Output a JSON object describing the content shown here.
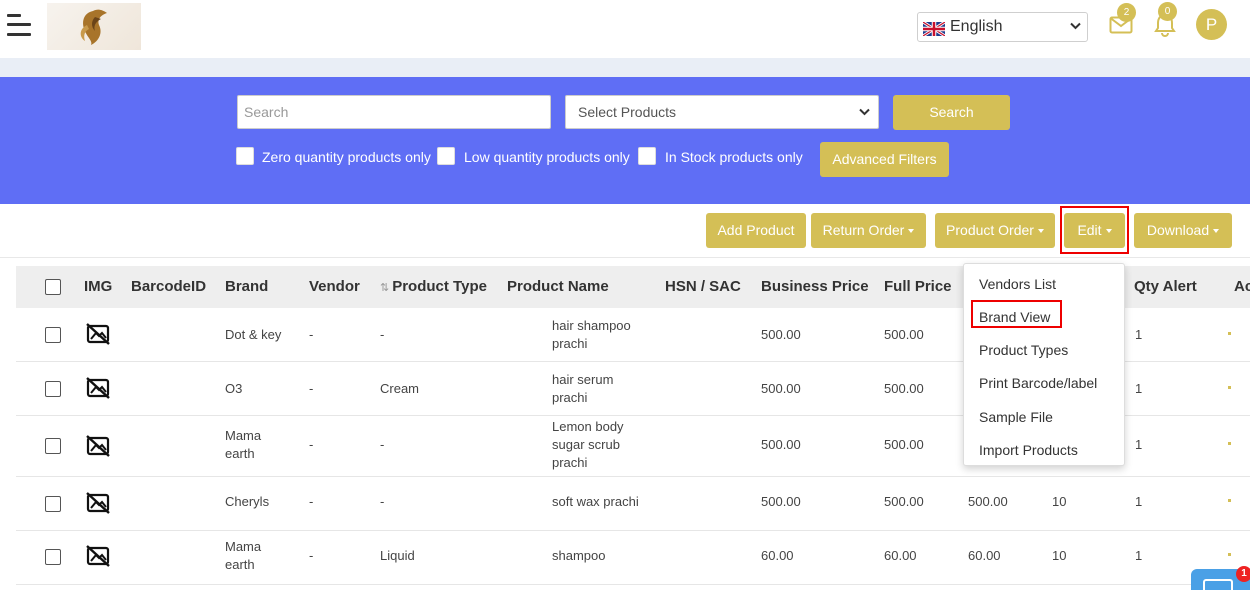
{
  "header": {
    "language": "English",
    "mail_count": "2",
    "notification_count": "0",
    "avatar_initial": "P"
  },
  "filters": {
    "search_placeholder": "Search",
    "select_products": "Select Products",
    "search_button": "Search",
    "advanced_filters_button": "Advanced Filters",
    "checkboxes": [
      {
        "label": "Zero quantity products only",
        "checked": false
      },
      {
        "label": "Low quantity products only",
        "checked": false
      },
      {
        "label": "In Stock products only",
        "checked": false
      }
    ]
  },
  "actions": {
    "add_product": "Add Product",
    "return_order": "Return Order",
    "product_order": "Product Order",
    "edit": "Edit",
    "download": "Download"
  },
  "edit_menu": {
    "items": [
      "Vendors List",
      "Brand View",
      "Product Types",
      "Print Barcode/label",
      "Sample File",
      "Import Products"
    ]
  },
  "table": {
    "columns": [
      "IMG",
      "BarcodeID",
      "Brand",
      "Vendor",
      "Product Type",
      "Product Name",
      "HSN / SAC",
      "Business Price",
      "Full Price",
      "Qty Alert",
      "Ac"
    ],
    "rows": [
      {
        "brand": [
          "Dot & key"
        ],
        "vendor": "-",
        "type": "-",
        "name": [
          "hair shampoo",
          "prachi"
        ],
        "business_price": "500.00",
        "full_price": "500.00",
        "price3": "",
        "qty": "",
        "qty_alert": "1"
      },
      {
        "brand": [
          "O3"
        ],
        "vendor": "-",
        "type": "Cream",
        "name": [
          "hair serum",
          "prachi"
        ],
        "business_price": "500.00",
        "full_price": "500.00",
        "price3": "",
        "qty": "",
        "qty_alert": "1"
      },
      {
        "brand": [
          "Mama",
          "earth"
        ],
        "vendor": "-",
        "type": "-",
        "name": [
          "Lemon body",
          "sugar scrub",
          "prachi"
        ],
        "business_price": "500.00",
        "full_price": "500.00",
        "price3": "",
        "qty": "",
        "qty_alert": "1"
      },
      {
        "brand": [
          "Cheryls"
        ],
        "vendor": "-",
        "type": "-",
        "name": [
          "soft wax prachi"
        ],
        "business_price": "500.00",
        "full_price": "500.00",
        "price3": "500.00",
        "qty": "10",
        "qty_alert": "1"
      },
      {
        "brand": [
          "Mama",
          "earth"
        ],
        "vendor": "-",
        "type": "Liquid",
        "name": [
          "shampoo"
        ],
        "business_price": "60.00",
        "full_price": "60.00",
        "price3": "60.00",
        "qty": "10",
        "qty_alert": "1"
      }
    ]
  },
  "chat": {
    "badge": "1"
  },
  "colors": {
    "accent": "#d4bf56",
    "panel": "#5f6ef5",
    "highlight": "#ee0000"
  }
}
